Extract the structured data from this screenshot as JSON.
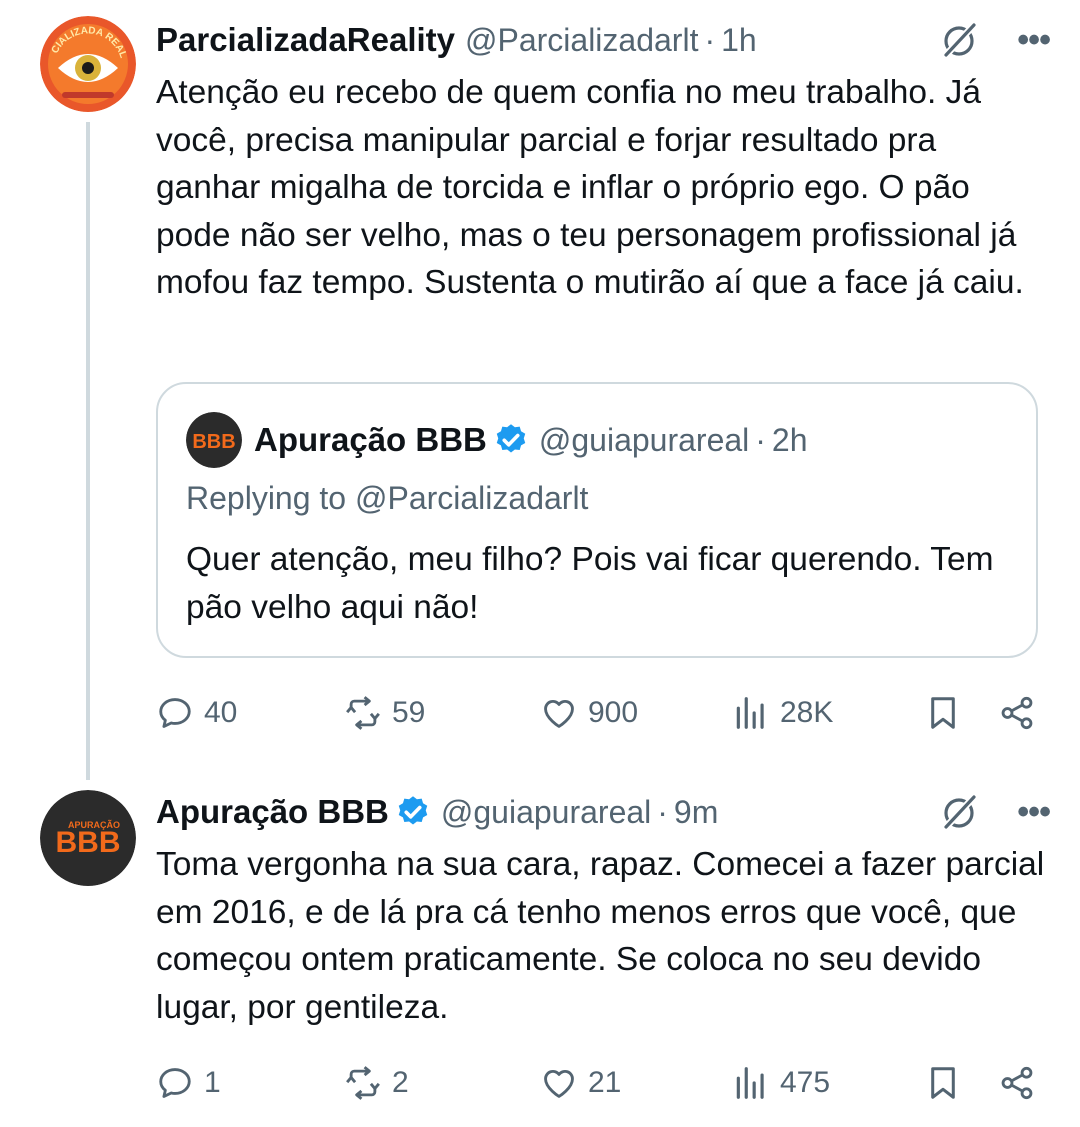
{
  "tweets": [
    {
      "author": {
        "name": "ParcializadaReality",
        "handle": "@Parcializadarlt",
        "avatar_text": "PARCIALIZADA REALITY"
      },
      "time": "1h",
      "text": "Atenção eu recebo de quem confia no meu trabalho. Já você, precisa manipular parcial e forjar resultado pra ganhar migalha de torcida e inflar o próprio ego. O pão pode não ser velho, mas o teu personagem profissional já mofou faz tempo. Sustenta o mutirão aí que a face já caiu.",
      "quote": {
        "author": {
          "name": "Apuração BBB",
          "handle": "@guiapurareal",
          "avatar_text": "BBB"
        },
        "time": "2h",
        "reply_to": "Replying to @Parcializadarlt",
        "text": "Quer atenção, meu filho? Pois vai ficar querendo. Tem pão velho aqui não!"
      },
      "stats": {
        "replies": "40",
        "reposts": "59",
        "likes": "900",
        "views": "28K"
      }
    },
    {
      "author": {
        "name": "Apuração BBB",
        "handle": "@guiapurareal",
        "avatar_text": "BBB",
        "avatar_small_text": "APURAÇÃO"
      },
      "time": "9m",
      "text": "Toma vergonha na sua cara, rapaz. Comecei a fazer parcial em 2016, e de lá pra cá tenho menos erros que você, que começou ontem praticamente. Se coloca no seu devido lugar, por gentileza.",
      "stats": {
        "replies": "1",
        "reposts": "2",
        "likes": "21",
        "views": "475"
      }
    }
  ],
  "ui": {
    "dot": "·",
    "more": "•••"
  },
  "colors": {
    "text": "#0f1419",
    "secondary": "#536471",
    "verified": "#1d9bf0",
    "border": "#cfd9de",
    "accent_orange": "#f26a1b"
  }
}
